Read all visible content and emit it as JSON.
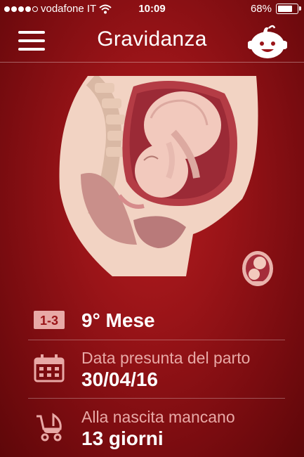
{
  "status_bar": {
    "carrier": "vodafone IT",
    "time": "10:09",
    "battery": "68%",
    "battery_level": 0.68
  },
  "nav": {
    "title": "Gravidanza",
    "menu_icon": "hamburger-icon",
    "baby_icon": "baby-face-icon"
  },
  "illustration": {
    "main_icon": "pregnancy-cross-section-illustration",
    "thumb_icon": "fetus-thumbnail-icon"
  },
  "rows": [
    {
      "icon": "trimester-1-3-icon",
      "icon_text": "1-3",
      "sub": "",
      "main": "9° Mese"
    },
    {
      "icon": "calendar-icon",
      "sub": "Data presunta del parto",
      "main": "30/04/16"
    },
    {
      "icon": "stroller-icon",
      "sub": "Alla nascita mancano",
      "main": "13 giorni"
    }
  ],
  "colors": {
    "background": "#9a1418",
    "subtext": "#e8a9a6",
    "text": "#ffffff"
  }
}
